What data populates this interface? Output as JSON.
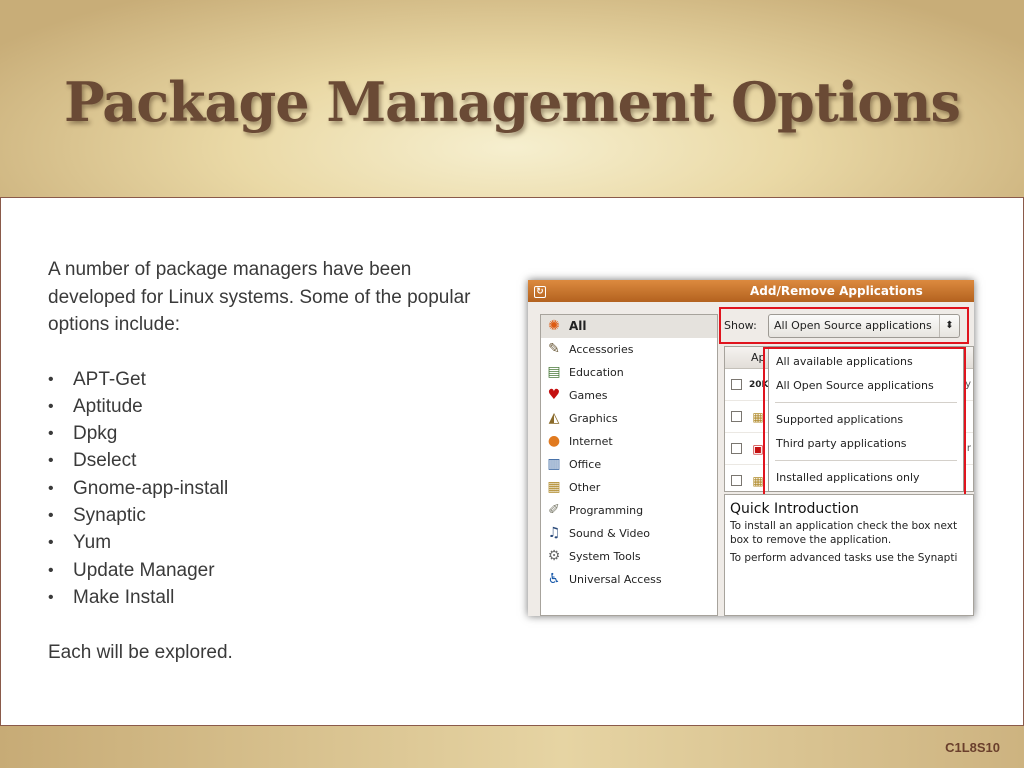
{
  "slide": {
    "title": "Package Management Options",
    "intro": "A number of package managers have been developed for Linux systems. Some of the popular options include:",
    "bullets": [
      "APT-Get",
      "Aptitude",
      "Dpkg",
      "Dselect",
      "Gnome-app-install",
      "Synaptic",
      "Yum",
      "Update Manager",
      "Make Install"
    ],
    "outro": "Each will be explored.",
    "slide_id": "C1L8S10"
  },
  "window": {
    "title": "Add/Remove Applications",
    "categories": [
      {
        "label": "All",
        "icon": "ubuntu-logo-icon"
      },
      {
        "label": "Accessories",
        "icon": "accessories-icon"
      },
      {
        "label": "Education",
        "icon": "education-icon"
      },
      {
        "label": "Games",
        "icon": "games-icon"
      },
      {
        "label": "Graphics",
        "icon": "graphics-icon"
      },
      {
        "label": "Internet",
        "icon": "internet-globe-icon"
      },
      {
        "label": "Office",
        "icon": "office-chart-icon"
      },
      {
        "label": "Other",
        "icon": "other-icon"
      },
      {
        "label": "Programming",
        "icon": "programming-icon"
      },
      {
        "label": "Sound & Video",
        "icon": "sound-video-icon"
      },
      {
        "label": "System Tools",
        "icon": "system-tools-gear-icon"
      },
      {
        "label": "Universal Access",
        "icon": "universal-access-icon"
      }
    ],
    "show_label": "Show:",
    "show_value": "All Open Source applications",
    "list_header": "Ap",
    "row_fragments": [
      "ty",
      "ar"
    ],
    "dropdown_options": [
      "All available applications",
      "All Open Source applications",
      "Supported applications",
      "Third party applications",
      "Installed applications only"
    ],
    "quick_intro_title": "Quick Introduction",
    "quick_intro_line1": "To install an application check the box next",
    "quick_intro_line2": "box to remove the application.",
    "quick_intro_line3": "To perform advanced tasks use the Synapti"
  },
  "colors": {
    "title_text": "#6a4a35",
    "window_titlebar": "#c9702b",
    "highlight_box": "#e0141e"
  }
}
